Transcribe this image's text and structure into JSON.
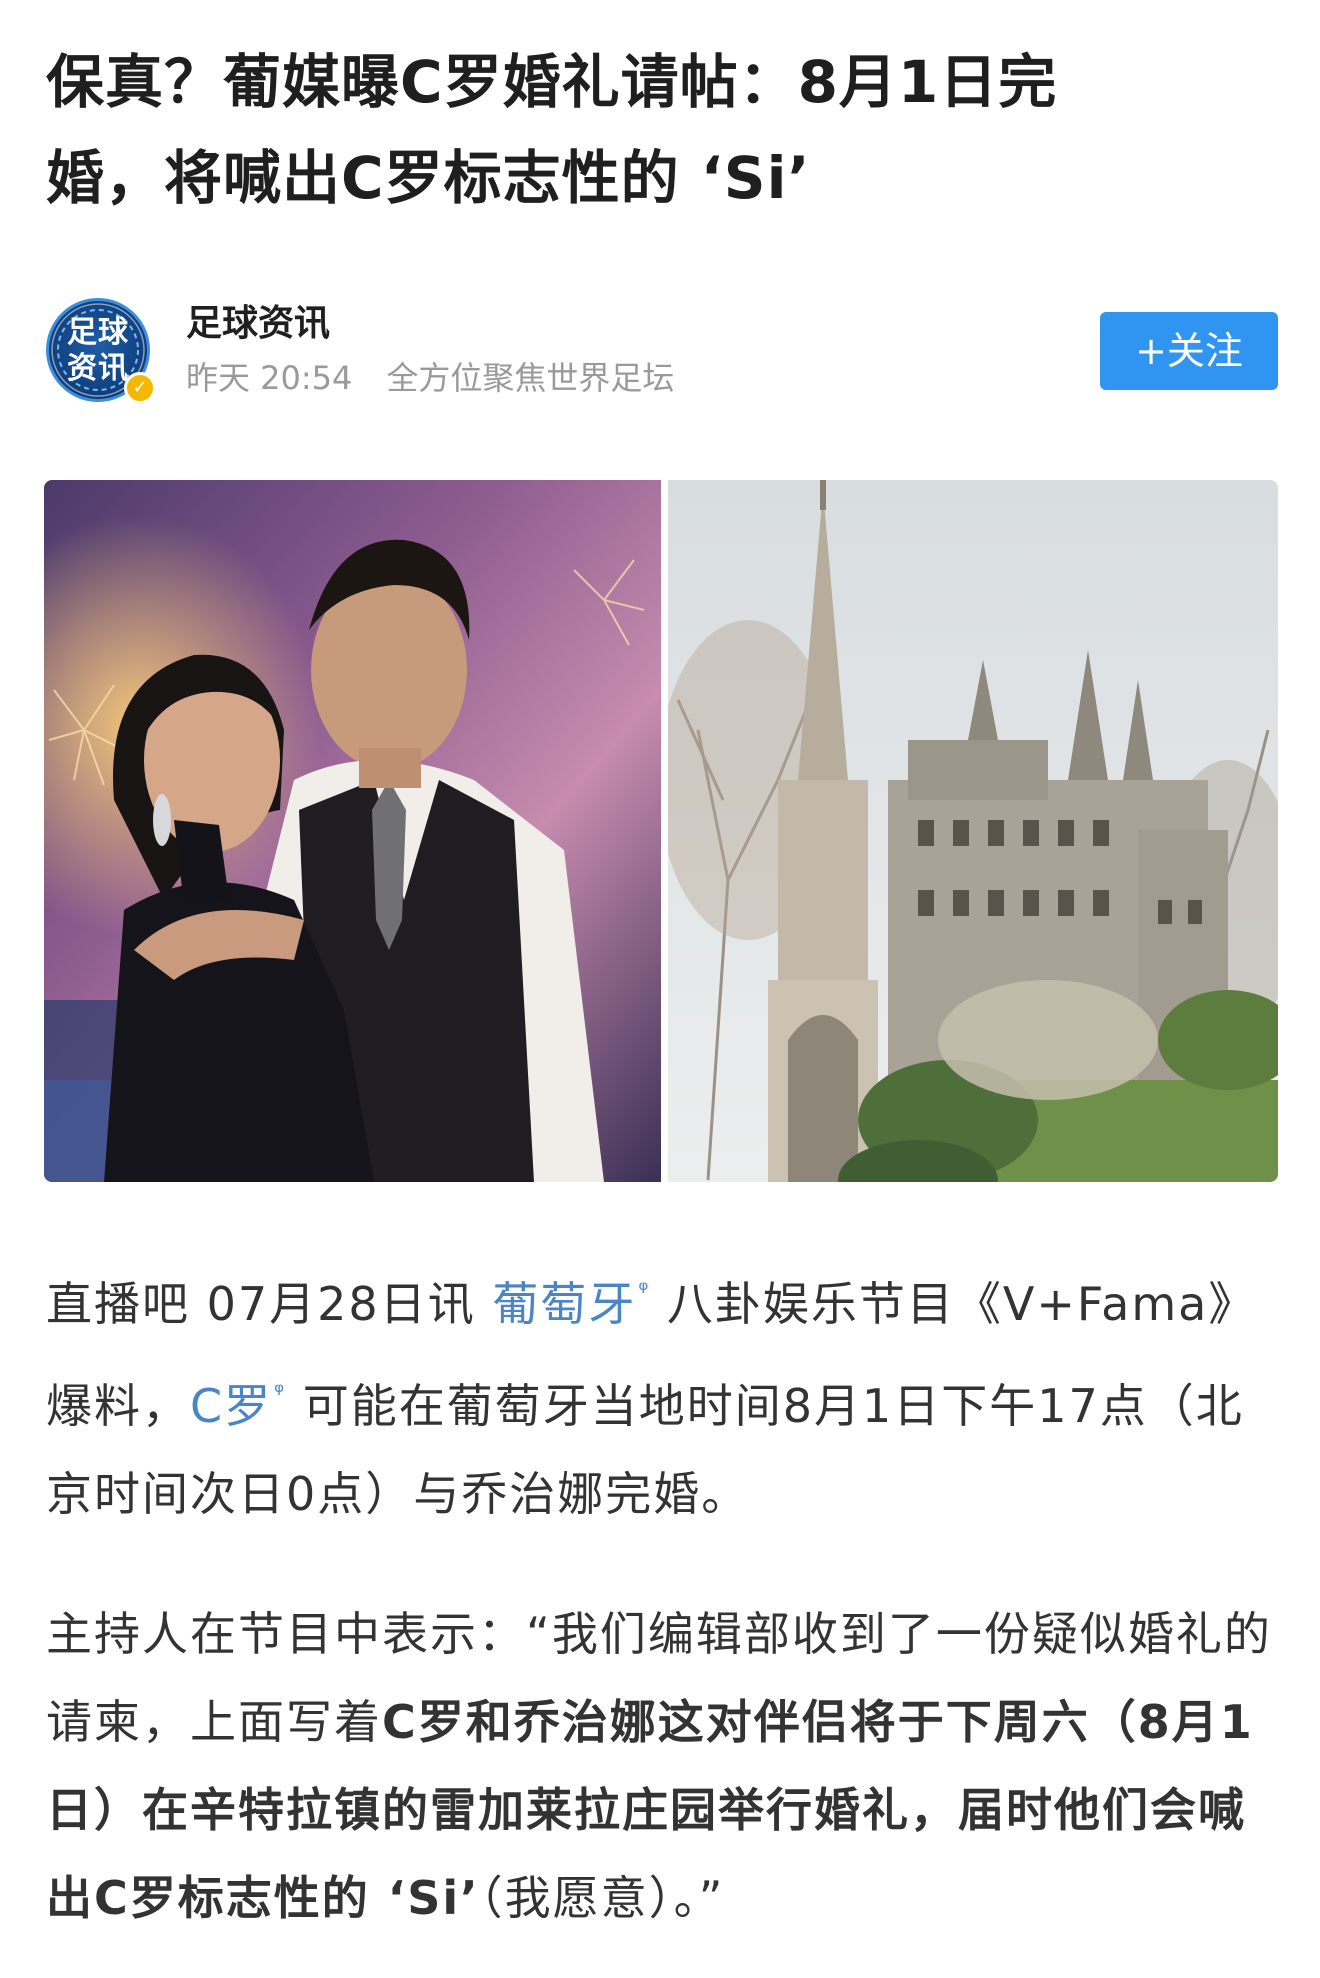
{
  "article": {
    "title_line1": "保真？葡媒曝C罗婚礼请帖：8月1日完",
    "title_line2": "婚，将喊出C罗标志性的 ‘Si’"
  },
  "author": {
    "avatar_text_line1": "足球",
    "avatar_text_line2": "资讯",
    "name": "足球资讯",
    "time": "昨天 20:54",
    "bio": "全方位聚焦世界足坛",
    "follow_label": "+关注",
    "verified": true
  },
  "colors": {
    "accent": "#2f95f0",
    "link": "#4a86c5",
    "meta": "#9a9a9a",
    "verified_badge": "#f5b800"
  },
  "body": {
    "p1_prefix": "直播吧 07月28日讯  ",
    "p1_link1": "葡萄牙",
    "p1_mid1": " 八卦娱乐节目《V+Fama》爆料，",
    "p1_link2": "C罗",
    "p1_rest": " 可能在葡萄牙当地时间8月1日下午17点（北京时间次日0点）与乔治娜完婚。",
    "p2_prefix": "主持人在节目中表示：“我们编辑部收到了一份疑似婚礼的请柬，上面写着",
    "p2_bold": "C罗和乔治娜这对伴侣将于下周六（8月1日）在辛特拉镇的雷加莱拉庄园举行婚礼，届时他们会喊出C罗标志性的 ‘Si’",
    "p2_suffix": "（我愿意）。”"
  },
  "icons": {
    "search_link_icon": "search-link-icon",
    "verified_icon": "verified-check-icon"
  }
}
